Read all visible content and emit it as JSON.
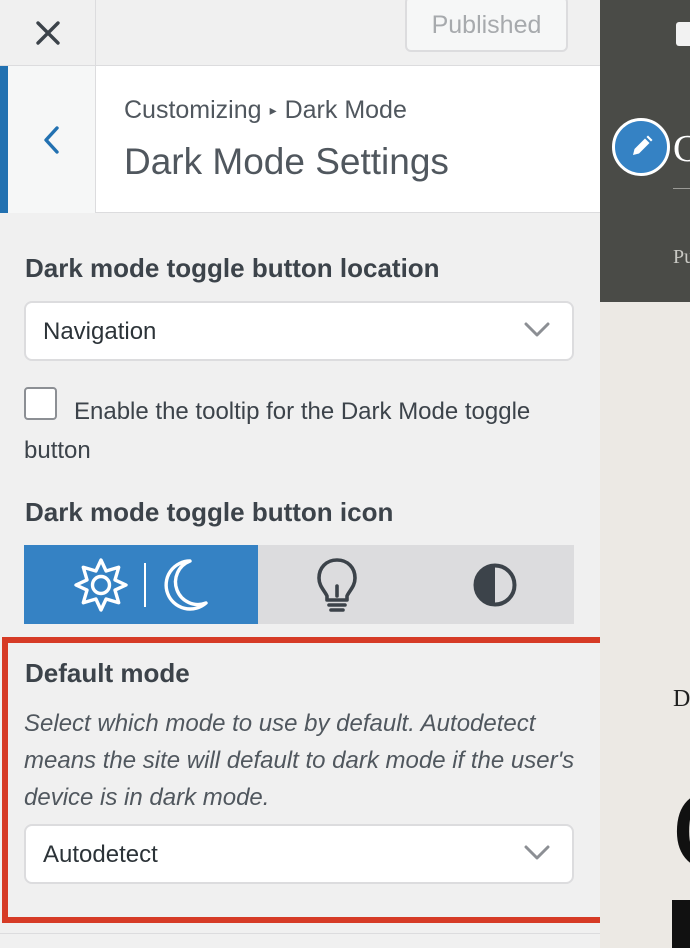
{
  "topbar": {
    "publish_label": "Published"
  },
  "header": {
    "breadcrumb_root": "Customizing",
    "breadcrumb_separator": "▸",
    "breadcrumb_current": "Dark Mode",
    "title": "Dark Mode Settings"
  },
  "toggle_location": {
    "label": "Dark mode toggle button location",
    "selected": "Navigation"
  },
  "tooltip_option": {
    "checked": false,
    "label": "Enable the tooltip for the Dark Mode toggle button"
  },
  "toggle_icon": {
    "label": "Dark mode toggle button icon",
    "options": [
      {
        "icon": "sun-moon-icon",
        "selected": true
      },
      {
        "icon": "lightbulb-icon",
        "selected": false
      },
      {
        "icon": "half-circle-contrast-icon",
        "selected": false
      }
    ]
  },
  "default_mode": {
    "label": "Default mode",
    "description": "Select which mode to use by default. Autodetect means the site will default to dark mode if the user's device is in dark mode.",
    "selected": "Autodetect"
  },
  "preview": {
    "nav_text": "Pu",
    "content_letter": "D",
    "heading_glyph": "C"
  },
  "colors": {
    "accent": "#3582c4",
    "back_bar": "#2271b1",
    "highlight_border": "#d63b26",
    "preview_header": "#4a4b47"
  }
}
